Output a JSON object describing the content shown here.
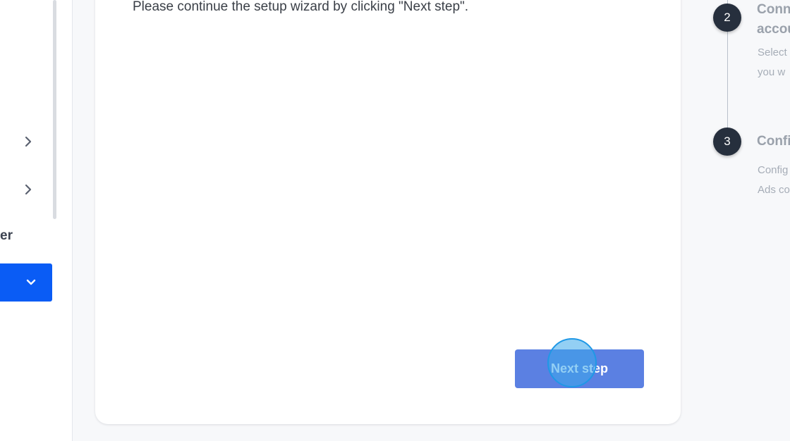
{
  "sidebar": {
    "label": "er",
    "icons": {
      "chevron_right": "chevron-right-icon",
      "chevron_down": "chevron-down-icon"
    }
  },
  "main": {
    "message": "Please continue the setup wizard by clicking \"Next step\".",
    "next_button_label": "Next step"
  },
  "steps": [
    {
      "number": "2",
      "title_line1": "Conn",
      "title_line2": "accou",
      "desc_line1": "Select",
      "desc_line2": "you w"
    },
    {
      "number": "3",
      "title_line1": "Confi",
      "desc_line1": "Config",
      "desc_line2": "Ads co"
    }
  ],
  "colors": {
    "accent": "#0a5cf5",
    "button": "#5b80e2",
    "step_circle": "#262f3d",
    "click_indicator": "#1f98e6"
  }
}
